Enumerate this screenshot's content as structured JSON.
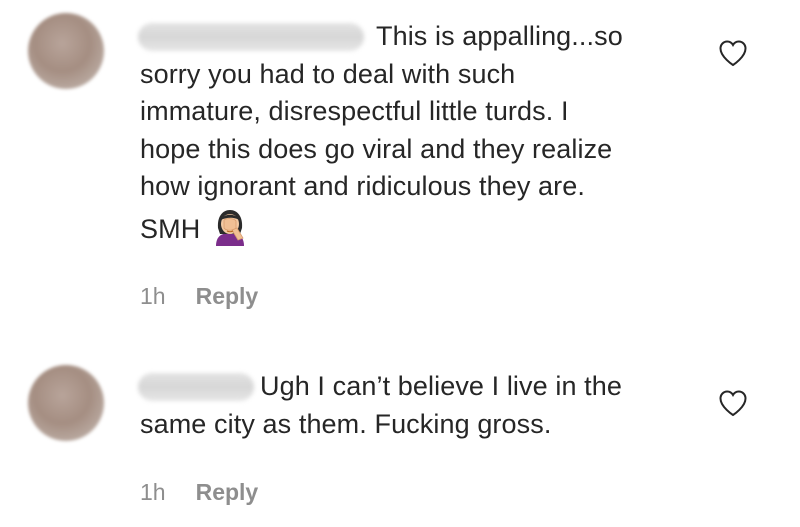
{
  "comments": [
    {
      "lines": [
        "This is appalling...so",
        "sorry you had to deal with such",
        "immature, disrespectful little turds. I",
        "hope this does go viral and they realize",
        "how ignorant and ridiculous they are.",
        "SMH"
      ],
      "emoji_icon": "woman-facepalming-icon",
      "time": "1h",
      "reply_label": "Reply",
      "like_icon": "heart-outline-icon"
    },
    {
      "lines": [
        "Ugh I can’t believe I live in the",
        "same city as them. Fucking gross."
      ],
      "time": "1h",
      "reply_label": "Reply",
      "like_icon": "heart-outline-icon"
    }
  ],
  "colors": {
    "text": "#262626",
    "meta": "#8e8e8e",
    "background": "#ffffff"
  }
}
